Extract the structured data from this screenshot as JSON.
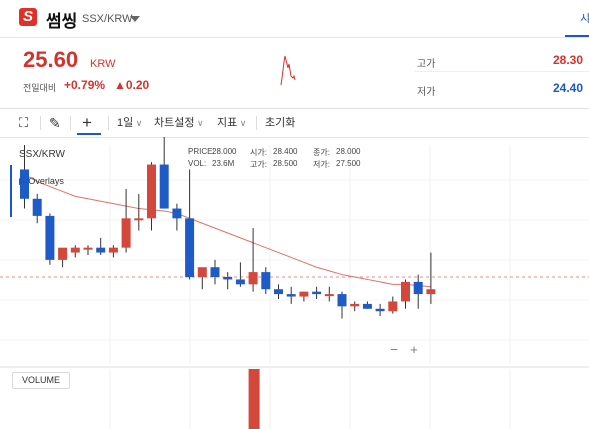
{
  "header": {
    "logo_glyph": "S",
    "coin_name": "썸씽",
    "pair": "SSX/KRW",
    "tab_edge": "시"
  },
  "ticker": {
    "price": "25.60",
    "unit": "KRW",
    "change_label": "전일대비",
    "change_pct": "+0.79%",
    "change_amt": "▲0.20",
    "high_label": "고가",
    "high_value": "28.30",
    "low_label": "저가",
    "low_value": "24.40",
    "high_color": "#d4332b",
    "low_color": "#1a57c8"
  },
  "toolbar": {
    "fullscreen_icon": "⛶",
    "pen_icon": "✎",
    "cross_icon": "+",
    "interval": "1일",
    "chart_settings": "차트설정",
    "indicators": "지표",
    "reset": "초기화"
  },
  "chart": {
    "symbol_label": "SSX/KRW",
    "overlays_label": "Overlays",
    "volume_label": "VOLUME",
    "zoom_minus": "−",
    "zoom_plus": "+",
    "ohlc": {
      "price_label": "PRICE:",
      "price_value": "28.000",
      "open_label": "시가:",
      "open_value": "28.400",
      "close_label": "종가:",
      "close_value": "28.000",
      "vol_label": "VOL:",
      "vol_value": "23.6M",
      "high_label": "고가:",
      "high_value": "28.500",
      "low_label": "저가:",
      "low_value": "27.500"
    }
  },
  "chart_data": {
    "type": "candlestick",
    "title": "SSX/KRW",
    "up_color": "#d4473b",
    "down_color": "#1e5bc6",
    "ma_color": "#e0706a",
    "last_price": 25.6,
    "ylim": [
      22.0,
      31.0
    ],
    "candles": [
      {
        "o": 30.0,
        "h": 31.0,
        "l": 28.4,
        "c": 28.8
      },
      {
        "o": 28.8,
        "h": 29.0,
        "l": 27.8,
        "c": 28.1
      },
      {
        "o": 28.1,
        "h": 28.2,
        "l": 26.1,
        "c": 26.3
      },
      {
        "o": 26.3,
        "h": 26.6,
        "l": 26.0,
        "c": 26.8
      },
      {
        "o": 26.6,
        "h": 26.9,
        "l": 26.4,
        "c": 26.8
      },
      {
        "o": 26.8,
        "h": 26.9,
        "l": 26.5,
        "c": 26.8
      },
      {
        "o": 26.8,
        "h": 27.2,
        "l": 26.5,
        "c": 26.6
      },
      {
        "o": 26.6,
        "h": 26.9,
        "l": 26.4,
        "c": 26.8
      },
      {
        "o": 26.8,
        "h": 29.2,
        "l": 26.6,
        "c": 28.0
      },
      {
        "o": 28.0,
        "h": 29.0,
        "l": 27.5,
        "c": 28.0
      },
      {
        "o": 28.0,
        "h": 30.3,
        "l": 27.5,
        "c": 30.2
      },
      {
        "o": 30.2,
        "h": 31.4,
        "l": 28.4,
        "c": 28.4
      },
      {
        "o": 28.4,
        "h": 28.6,
        "l": 27.5,
        "c": 28.0
      },
      {
        "o": 28.0,
        "h": 30.0,
        "l": 25.5,
        "c": 25.6
      },
      {
        "o": 25.6,
        "h": 25.8,
        "l": 25.1,
        "c": 26.0
      },
      {
        "o": 26.0,
        "h": 26.3,
        "l": 25.3,
        "c": 25.6
      },
      {
        "o": 25.6,
        "h": 25.8,
        "l": 25.1,
        "c": 25.5
      },
      {
        "o": 25.5,
        "h": 26.2,
        "l": 25.2,
        "c": 25.3
      },
      {
        "o": 25.3,
        "h": 27.6,
        "l": 25.0,
        "c": 25.8
      },
      {
        "o": 25.8,
        "h": 26.0,
        "l": 24.9,
        "c": 25.1
      },
      {
        "o": 25.1,
        "h": 25.3,
        "l": 24.7,
        "c": 24.9
      },
      {
        "o": 24.9,
        "h": 25.2,
        "l": 24.5,
        "c": 24.8
      },
      {
        "o": 24.8,
        "h": 25.0,
        "l": 24.6,
        "c": 25.0
      },
      {
        "o": 25.0,
        "h": 25.2,
        "l": 24.7,
        "c": 24.9
      },
      {
        "o": 24.9,
        "h": 25.2,
        "l": 24.6,
        "c": 24.9
      },
      {
        "o": 24.9,
        "h": 25.0,
        "l": 23.9,
        "c": 24.4
      },
      {
        "o": 24.4,
        "h": 24.6,
        "l": 24.2,
        "c": 24.5
      },
      {
        "o": 24.5,
        "h": 24.6,
        "l": 24.3,
        "c": 24.3
      },
      {
        "o": 24.3,
        "h": 24.5,
        "l": 24.0,
        "c": 24.2
      },
      {
        "o": 24.2,
        "h": 24.8,
        "l": 24.1,
        "c": 24.6
      },
      {
        "o": 24.6,
        "h": 25.5,
        "l": 24.3,
        "c": 25.4
      },
      {
        "o": 25.4,
        "h": 25.7,
        "l": 24.3,
        "c": 24.9
      },
      {
        "o": 24.9,
        "h": 26.6,
        "l": 24.5,
        "c": 25.1
      }
    ],
    "ma": [
      29.8,
      29.5,
      29.3,
      29.1,
      28.9,
      28.8,
      28.7,
      28.6,
      28.5,
      28.4,
      28.35,
      28.3,
      28.2,
      28.0,
      27.8,
      27.6,
      27.4,
      27.2,
      27.0,
      26.8,
      26.6,
      26.4,
      26.2,
      26.0,
      25.85,
      25.7,
      25.6,
      25.5,
      25.4,
      25.3,
      25.3,
      25.25,
      25.2
    ],
    "volumes": [
      0,
      0,
      0,
      0,
      0,
      0,
      0,
      0,
      0,
      0,
      0,
      0,
      0,
      0,
      0,
      0,
      0,
      0,
      60,
      0,
      0,
      0,
      0,
      0,
      0,
      0,
      0,
      0,
      0,
      0,
      0,
      0,
      0
    ]
  }
}
